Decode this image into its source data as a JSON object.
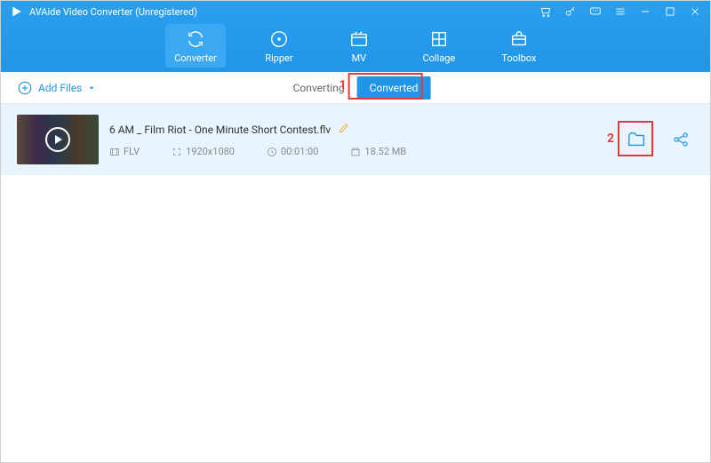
{
  "titlebar": {
    "title": "AVAide Video Converter (Unregistered)"
  },
  "tabs": {
    "converter": "Converter",
    "ripper": "Ripper",
    "mv": "MV",
    "collage": "Collage",
    "toolbox": "Toolbox"
  },
  "subbar": {
    "add_files": "Add Files",
    "converting": "Converting",
    "converted": "Converted"
  },
  "item": {
    "filename": "6 AM _ Film Riot - One Minute Short Contest.flv",
    "format": "FLV",
    "resolution": "1920x1080",
    "duration": "00:01:00",
    "size": "18.52 MB"
  },
  "annotations": {
    "step1": "1",
    "step2": "2"
  }
}
